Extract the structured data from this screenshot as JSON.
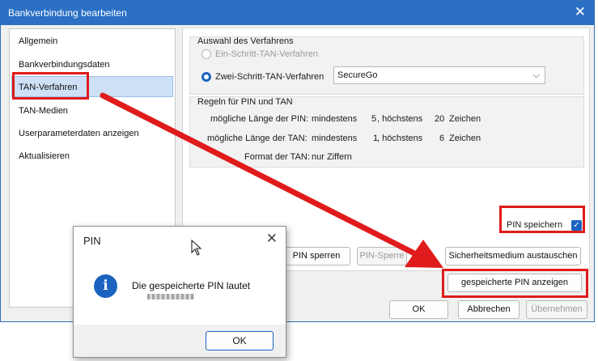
{
  "window": {
    "title": "Bankverbindung bearbeiten",
    "close_glyph": "✕"
  },
  "nav": {
    "items": [
      {
        "label": "Allgemein"
      },
      {
        "label": "Bankverbindungsdaten"
      },
      {
        "label": "TAN-Verfahren",
        "selected": true
      },
      {
        "label": "TAN-Medien"
      },
      {
        "label": "Userparameterdaten anzeigen"
      },
      {
        "label": "Aktualisieren"
      }
    ]
  },
  "verfahren": {
    "legend": "Auswahl des Verfahrens",
    "option1": "Ein-Schritt-TAN-Verfahren",
    "option2": "Zwei-Schritt-TAN-Verfahren",
    "selected_value": "SecureGo",
    "chevron": "⌵"
  },
  "regeln": {
    "legend": "Regeln für PIN und TAN",
    "pin_label": "mögliche Länge der PIN:",
    "pin_min_label": "mindestens",
    "pin_min": "5",
    "pin_max_label": ", höchstens",
    "pin_max": "20",
    "pin_unit": "Zeichen",
    "tan_label": "mögliche Länge der TAN:",
    "tan_min_label": "mindestens",
    "tan_min": "1",
    "tan_max_label": ", höchstens",
    "tan_max": "6",
    "tan_unit": "Zeichen",
    "format_label": "Format der TAN:",
    "format_value": "nur Ziffern"
  },
  "pin_save": {
    "label": "PIN speichern",
    "checked": true,
    "check_glyph": "✓"
  },
  "buttons": {
    "pin_sperren": "PIN sperren",
    "pin_sperre": "PIN-Sperre",
    "sicherheitsmedium": "Sicherheitsmedium austauschen",
    "pin_anzeigen": "gespeicherte PIN anzeigen",
    "ok": "OK",
    "abbrechen": "Abbrechen",
    "uebernehmen": "Übernehmen"
  },
  "pin_dialog": {
    "title": "PIN",
    "close_glyph": "✕",
    "info_glyph": "i",
    "message": "Die gespeicherte PIN lautet",
    "ok": "OK"
  },
  "colors": {
    "accent": "#2b70c4",
    "highlight": "#e01b1b"
  }
}
